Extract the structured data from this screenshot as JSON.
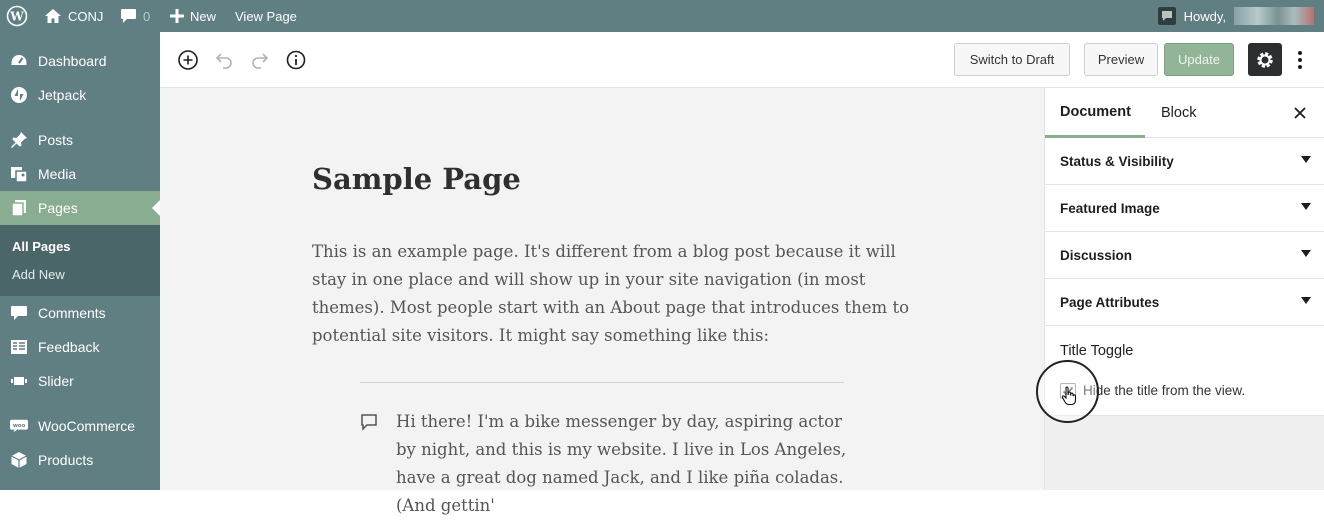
{
  "adminbar": {
    "site_name": "CONJ",
    "comments_count": "0",
    "new_label": "New",
    "view_page_label": "View Page",
    "howdy_label": "Howdy,"
  },
  "sidebar": {
    "items": [
      {
        "label": "Dashboard",
        "icon": "dashboard-icon"
      },
      {
        "label": "Jetpack",
        "icon": "jetpack-icon"
      },
      {
        "label": "Posts",
        "icon": "pin-icon"
      },
      {
        "label": "Media",
        "icon": "media-icon"
      },
      {
        "label": "Pages",
        "icon": "pages-icon"
      },
      {
        "label": "Comments",
        "icon": "comment-icon"
      },
      {
        "label": "Feedback",
        "icon": "feedback-icon"
      },
      {
        "label": "Slider",
        "icon": "slider-icon"
      },
      {
        "label": "WooCommerce",
        "icon": "woo-icon"
      },
      {
        "label": "Products",
        "icon": "products-icon"
      }
    ],
    "submenu": [
      "All Pages",
      "Add New"
    ]
  },
  "toolbar": {
    "switch_draft_label": "Switch to Draft",
    "preview_label": "Preview",
    "update_label": "Update"
  },
  "editor": {
    "title": "Sample Page",
    "paragraph": "This is an example page. It's different from a blog post because it will stay in one place and will show up in your site navigation (in most themes). Most people start with an About page that introduces them to potential site visitors. It might say something like this:",
    "quote": "Hi there! I'm a bike messenger by day, aspiring actor by night, and this is my website. I live in Los Angeles, have a great dog named Jack, and I like piña coladas. (And gettin'"
  },
  "panel": {
    "tabs": [
      "Document",
      "Block"
    ],
    "sections": [
      "Status & Visibility",
      "Featured Image",
      "Discussion",
      "Page Attributes"
    ],
    "toggle_title": "Title Toggle",
    "toggle_checkbox_label": "Hide the title from the view."
  },
  "colors": {
    "adminbar": "#5f7f83",
    "current_menu": "#88ad90",
    "update_button": "#92b497"
  }
}
